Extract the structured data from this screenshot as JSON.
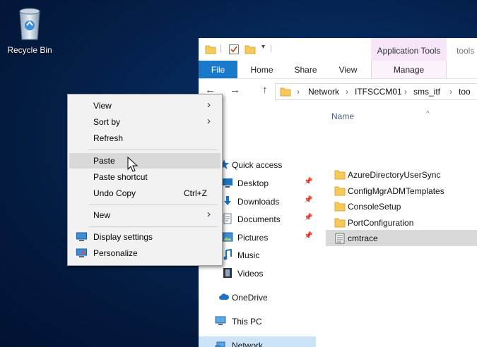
{
  "desktop": {
    "recycle_bin_label": "Recycle Bin"
  },
  "explorer": {
    "contextual_tab_group": "Application Tools",
    "window_title": "tools",
    "ribbon_tabs": [
      "File",
      "Home",
      "Share",
      "View",
      "Manage"
    ],
    "address_path": [
      "Network",
      "ITFSCCM01",
      "sms_itf",
      "too"
    ],
    "nav_items": [
      {
        "label": "Quick access",
        "icon": "star-icon",
        "pinned": false
      },
      {
        "label": "Desktop",
        "icon": "desktop-icon",
        "pinned": true
      },
      {
        "label": "Downloads",
        "icon": "download-icon",
        "pinned": true
      },
      {
        "label": "Documents",
        "icon": "document-icon",
        "pinned": true
      },
      {
        "label": "Pictures",
        "icon": "pictures-icon",
        "pinned": true
      },
      {
        "label": "Music",
        "icon": "music-icon",
        "pinned": false
      },
      {
        "label": "Videos",
        "icon": "video-icon",
        "pinned": false
      },
      {
        "label": "OneDrive",
        "icon": "cloud-icon",
        "pinned": false
      },
      {
        "label": "This PC",
        "icon": "computer-icon",
        "pinned": false
      },
      {
        "label": "Network",
        "icon": "network-icon",
        "pinned": false,
        "selected": true
      }
    ],
    "column_header": "Name",
    "files": [
      {
        "name": "AzureDirectoryUserSync",
        "type": "folder"
      },
      {
        "name": "ConfigMgrADMTemplates",
        "type": "folder"
      },
      {
        "name": "ConsoleSetup",
        "type": "folder"
      },
      {
        "name": "PortConfiguration",
        "type": "folder"
      },
      {
        "name": "cmtrace",
        "type": "application",
        "selected": true
      }
    ]
  },
  "context_menu": {
    "items": [
      {
        "label": "View",
        "submenu": true
      },
      {
        "label": "Sort by",
        "submenu": true
      },
      {
        "label": "Refresh"
      },
      {
        "label": "Paste",
        "highlighted": true
      },
      {
        "label": "Paste shortcut"
      },
      {
        "label": "Undo Copy",
        "shortcut": "Ctrl+Z"
      },
      {
        "label": "New",
        "submenu": true
      },
      {
        "label": "Display settings",
        "icon": "display-icon"
      },
      {
        "label": "Personalize",
        "icon": "personalize-icon"
      }
    ]
  },
  "colors": {
    "desktop_bg": "#06285a",
    "file_tab": "#1979ca",
    "contextual_tab": "#f6e6f8",
    "selection": "#cce4f7",
    "folder": "#f5c95a"
  }
}
